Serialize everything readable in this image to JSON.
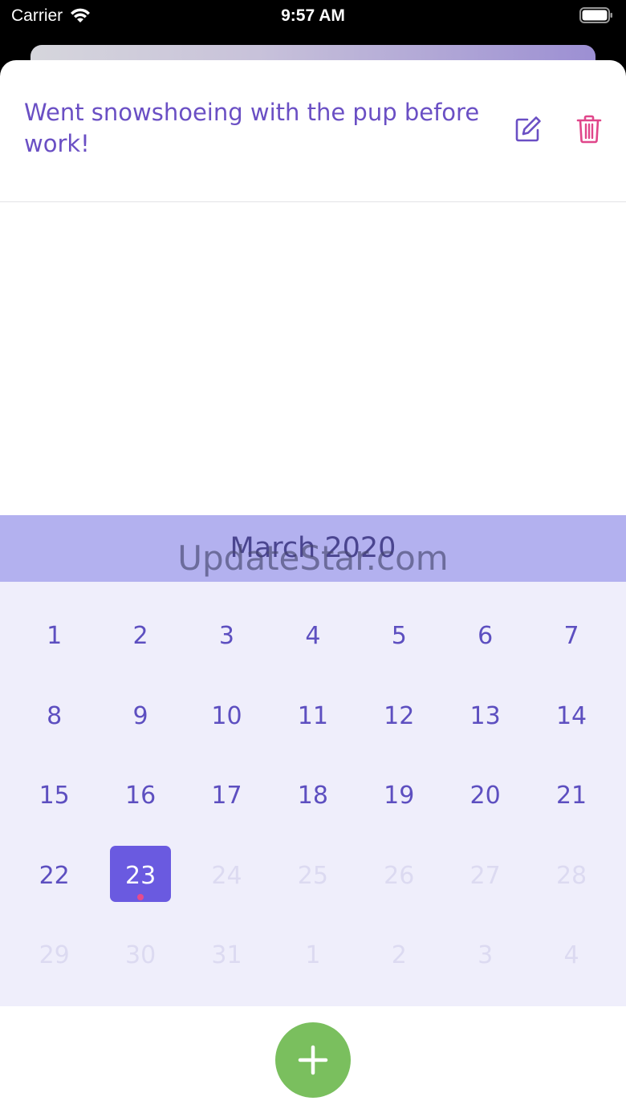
{
  "status_bar": {
    "carrier": "Carrier",
    "time": "9:57 AM"
  },
  "entry": {
    "text": "Went snowshoeing with the pup before work!"
  },
  "calendar": {
    "title": "March 2020",
    "days": [
      {
        "label": "1",
        "active": true
      },
      {
        "label": "2",
        "active": true
      },
      {
        "label": "3",
        "active": true
      },
      {
        "label": "4",
        "active": true
      },
      {
        "label": "5",
        "active": true
      },
      {
        "label": "6",
        "active": true
      },
      {
        "label": "7",
        "active": true
      },
      {
        "label": "8",
        "active": true
      },
      {
        "label": "9",
        "active": true
      },
      {
        "label": "10",
        "active": true
      },
      {
        "label": "11",
        "active": true
      },
      {
        "label": "12",
        "active": true
      },
      {
        "label": "13",
        "active": true
      },
      {
        "label": "14",
        "active": true
      },
      {
        "label": "15",
        "active": true
      },
      {
        "label": "16",
        "active": true
      },
      {
        "label": "17",
        "active": true
      },
      {
        "label": "18",
        "active": true
      },
      {
        "label": "19",
        "active": true
      },
      {
        "label": "20",
        "active": true
      },
      {
        "label": "21",
        "active": true
      },
      {
        "label": "22",
        "active": true
      },
      {
        "label": "23",
        "active": true,
        "selected": true,
        "has_entry": true
      },
      {
        "label": "24",
        "active": false
      },
      {
        "label": "25",
        "active": false
      },
      {
        "label": "26",
        "active": false
      },
      {
        "label": "27",
        "active": false
      },
      {
        "label": "28",
        "active": false
      },
      {
        "label": "29",
        "active": false
      },
      {
        "label": "30",
        "active": false
      },
      {
        "label": "31",
        "active": false
      },
      {
        "label": "1",
        "active": false
      },
      {
        "label": "2",
        "active": false
      },
      {
        "label": "3",
        "active": false
      },
      {
        "label": "4",
        "active": false
      }
    ]
  },
  "watermark": "UpdateStar.com",
  "icons": {
    "wifi": "wifi-icon",
    "battery": "battery-icon",
    "edit": "edit-icon",
    "delete": "trash-icon",
    "add": "plus-icon"
  },
  "colors": {
    "accent": "#6a4fc4",
    "delete": "#e0468a",
    "calendar_header": "#b3b1ef",
    "calendar_body": "#efeefb",
    "selected_day": "#6a5ae0",
    "add_button": "#7abf5e"
  }
}
